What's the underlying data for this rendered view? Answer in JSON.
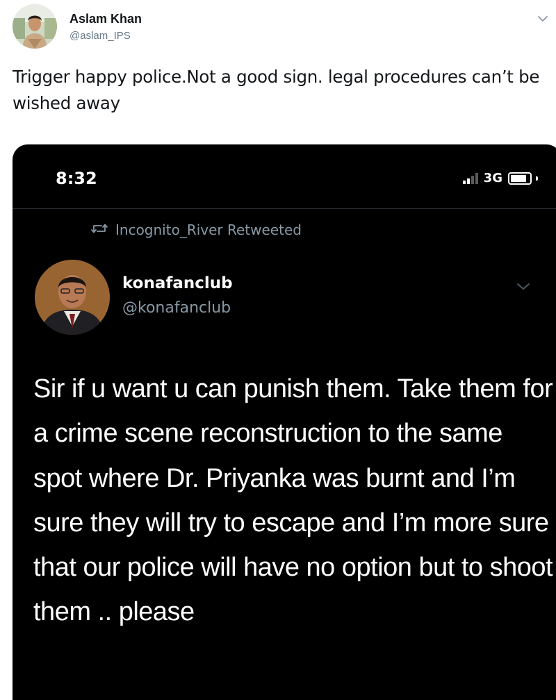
{
  "tweet": {
    "author_name": "Aslam Khan",
    "author_handle": "@aslam_IPS",
    "text": "Trigger happy police.Not a good sign. legal procedures can’t be wished away",
    "menu_icon": "chevron-down-icon"
  },
  "embedded_screenshot": {
    "status_bar": {
      "time": "8:32",
      "network": "3G",
      "signal_bars_active": 2,
      "signal_bars_total": 4,
      "battery_level": 0.85
    },
    "retweet": {
      "icon": "retweet-icon",
      "text": "Incognito_River Retweeted"
    },
    "inner_tweet": {
      "author_name": "konafanclub",
      "author_handle": "@konafanclub",
      "text": "Sir if u want u can punish them. Take them for a crime scene reconstruction to the same spot where Dr. Priyanka was burnt and I’m sure they will try to escape and I’m more sure that our police will have no option but to shoot them .. please",
      "menu_icon": "chevron-down-icon"
    }
  },
  "colors": {
    "primary_text": "#14171a",
    "secondary_text": "#657786",
    "dark_background": "#000000",
    "dark_secondary_text": "#8899a6"
  }
}
